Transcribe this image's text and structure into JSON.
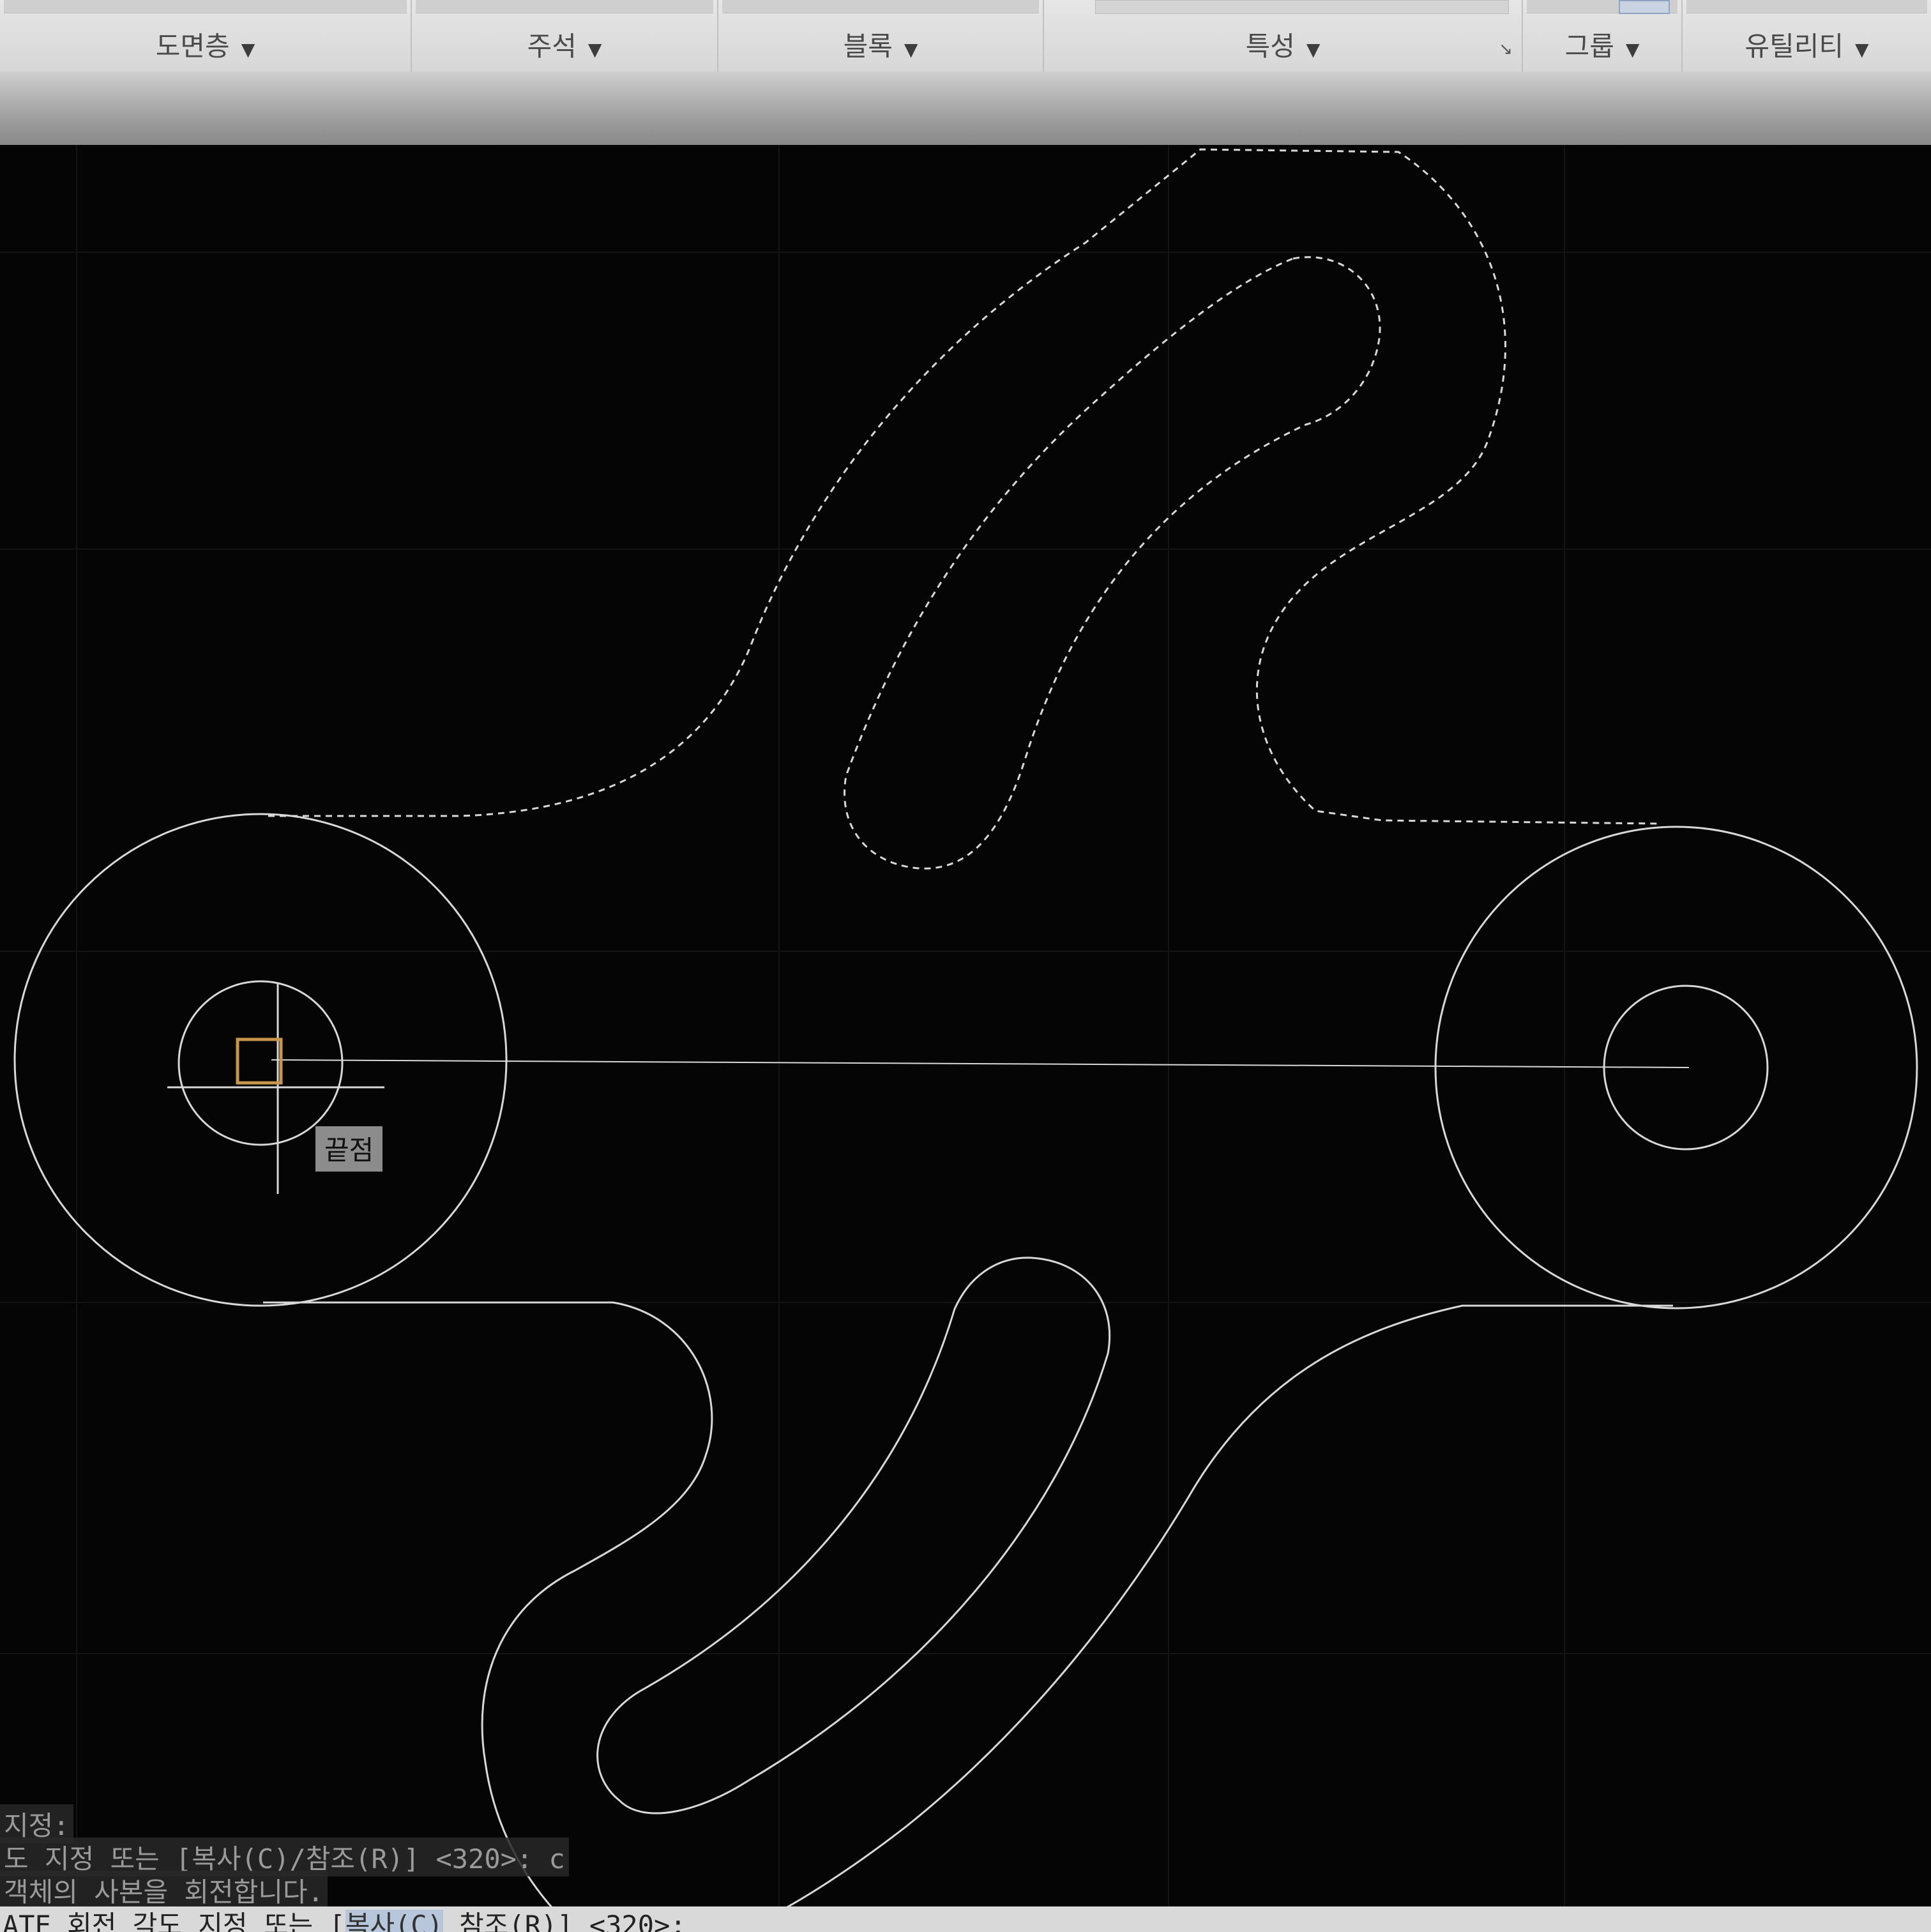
{
  "ribbon": {
    "panels": [
      {
        "id": "layers",
        "title": "도면층"
      },
      {
        "id": "annotation",
        "title": "주석"
      },
      {
        "id": "block",
        "title": "블록"
      },
      {
        "id": "properties",
        "title": "특성"
      },
      {
        "id": "groups",
        "title": "그룹"
      },
      {
        "id": "utilities",
        "title": "유틸리티"
      }
    ],
    "dropdown_glyph": "▼",
    "launcher_glyph": "↘"
  },
  "viewport": {
    "snap_tooltip": "끝점",
    "colors": {
      "background": "#050505",
      "geometry": "#d8d8d8",
      "preview_dashed": "#d8d8d8",
      "snap_marker": "#c8964a",
      "grid": "#141414"
    }
  },
  "command_line": {
    "history": [
      "지정:",
      "도 지정 또는 [복사(C)/참조(R)] <320>: c",
      "객체의 사본을 회전합니다."
    ],
    "prompt": {
      "command": "ATE 회전 각도 지정 또는 [",
      "option_copy": "복사(C)",
      "option_reference": "참조(R)",
      "suffix": "] <320>:"
    }
  }
}
